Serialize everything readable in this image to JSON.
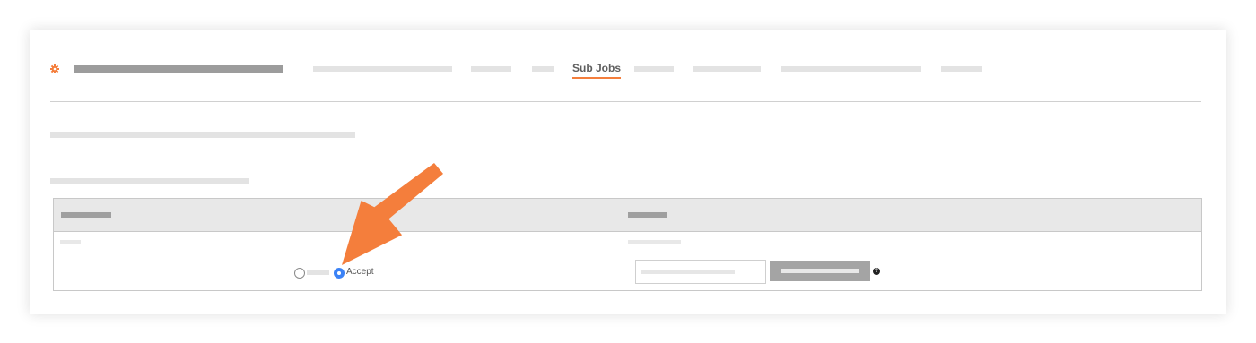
{
  "header": {
    "settings_icon": "gear-icon",
    "active_tab": "Sub Jobs"
  },
  "table": {
    "row2": {
      "accept_label": "Accept",
      "help_icon": "question-circle-icon",
      "help_glyph": "?"
    }
  },
  "colors": {
    "accent": "#f47e3c",
    "radio_selected": "#3b82f6",
    "annotation_arrow": "#f47e3c"
  }
}
